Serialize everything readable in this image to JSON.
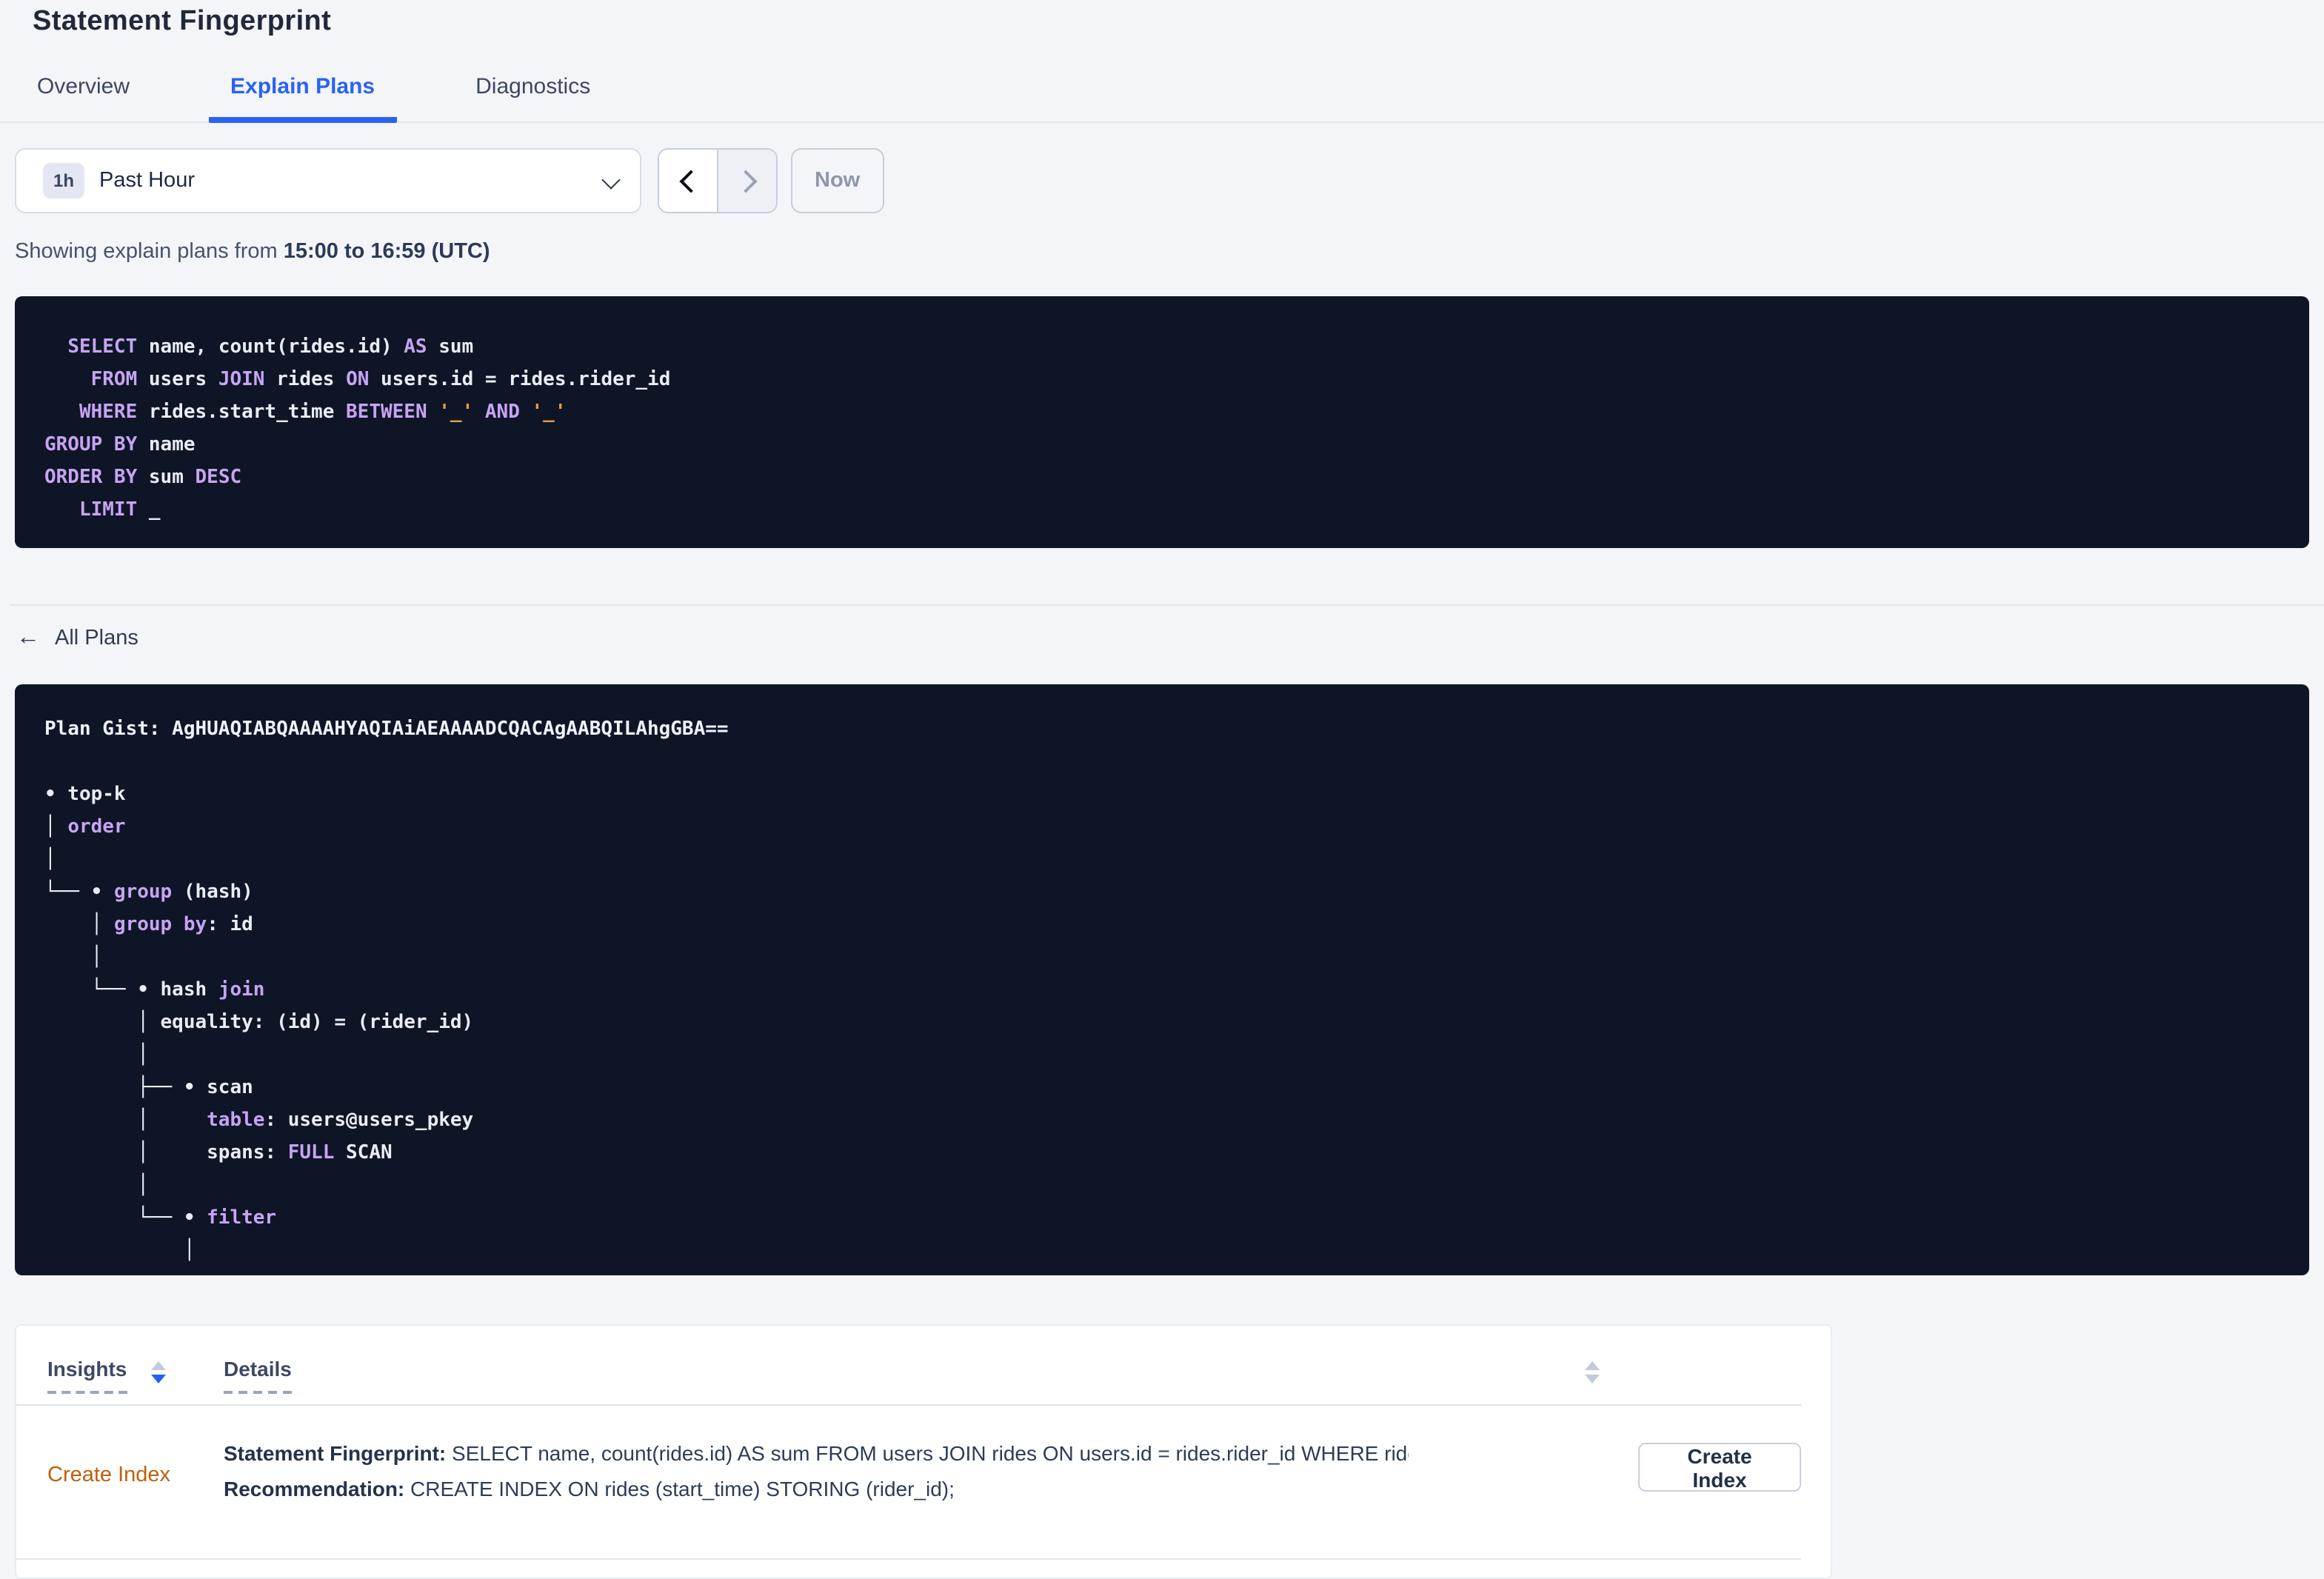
{
  "page": {
    "title": "Statement Fingerprint"
  },
  "tabs": [
    {
      "label": "Overview",
      "active": false
    },
    {
      "label": "Explain Plans",
      "active": true
    },
    {
      "label": "Diagnostics",
      "active": false
    }
  ],
  "time_picker": {
    "badge": "1h",
    "label": "Past Hour",
    "now_label": "Now"
  },
  "showing": {
    "prefix": "Showing explain plans from ",
    "bold": "15:00 to 16:59 (UTC)"
  },
  "sql": {
    "lines": [
      [
        {
          "t": "  ",
          "c": "pl"
        },
        {
          "t": "SELECT",
          "c": "kw"
        },
        {
          "t": " name, count(rides.id) ",
          "c": "pl"
        },
        {
          "t": "AS",
          "c": "kw"
        },
        {
          "t": " sum",
          "c": "pl"
        }
      ],
      [
        {
          "t": "    ",
          "c": "pl"
        },
        {
          "t": "FROM",
          "c": "kw"
        },
        {
          "t": " users ",
          "c": "pl"
        },
        {
          "t": "JOIN",
          "c": "kw"
        },
        {
          "t": " rides ",
          "c": "pl"
        },
        {
          "t": "ON",
          "c": "kw"
        },
        {
          "t": " users.id = rides.rider_id",
          "c": "pl"
        }
      ],
      [
        {
          "t": "   ",
          "c": "pl"
        },
        {
          "t": "WHERE",
          "c": "kw"
        },
        {
          "t": " rides.start_time ",
          "c": "pl"
        },
        {
          "t": "BETWEEN",
          "c": "kw"
        },
        {
          "t": " ",
          "c": "pl"
        },
        {
          "t": "'_'",
          "c": "lit"
        },
        {
          "t": " ",
          "c": "pl"
        },
        {
          "t": "AND",
          "c": "kw"
        },
        {
          "t": " ",
          "c": "pl"
        },
        {
          "t": "'_'",
          "c": "lit"
        }
      ],
      [
        {
          "t": "GROUP BY",
          "c": "kw"
        },
        {
          "t": " name",
          "c": "pl"
        }
      ],
      [
        {
          "t": "ORDER BY",
          "c": "kw"
        },
        {
          "t": " sum ",
          "c": "pl"
        },
        {
          "t": "DESC",
          "c": "kw"
        }
      ],
      [
        {
          "t": "   ",
          "c": "pl"
        },
        {
          "t": "LIMIT",
          "c": "kw"
        },
        {
          "t": " _",
          "c": "pl"
        }
      ]
    ]
  },
  "all_plans": {
    "label": "All Plans",
    "arrow": "←"
  },
  "plan": {
    "lines": [
      [
        {
          "t": "Plan Gist: AgHUAQIABQAAAAHYAQIAiAEAAAADCQACAgAABQILAhgGBA==",
          "c": "b"
        }
      ],
      [
        {
          "t": "",
          "c": "pl"
        }
      ],
      [
        {
          "t": "• top-k",
          "c": "pl"
        }
      ],
      [
        {
          "t": "│ ",
          "c": "pl"
        },
        {
          "t": "order",
          "c": "kw"
        }
      ],
      [
        {
          "t": "│",
          "c": "pl"
        }
      ],
      [
        {
          "t": "└── • ",
          "c": "pl"
        },
        {
          "t": "group",
          "c": "kw"
        },
        {
          "t": " (hash)",
          "c": "pl"
        }
      ],
      [
        {
          "t": "    │ ",
          "c": "pl"
        },
        {
          "t": "group by",
          "c": "kw"
        },
        {
          "t": ": id",
          "c": "pl"
        }
      ],
      [
        {
          "t": "    │",
          "c": "pl"
        }
      ],
      [
        {
          "t": "    └── • hash ",
          "c": "pl"
        },
        {
          "t": "join",
          "c": "kw"
        }
      ],
      [
        {
          "t": "        │ equality: (id) = (rider_id)",
          "c": "pl"
        }
      ],
      [
        {
          "t": "        │",
          "c": "pl"
        }
      ],
      [
        {
          "t": "        ├── • scan",
          "c": "pl"
        }
      ],
      [
        {
          "t": "        │     ",
          "c": "pl"
        },
        {
          "t": "table",
          "c": "kw"
        },
        {
          "t": ": users@users_pkey",
          "c": "pl"
        }
      ],
      [
        {
          "t": "        │     spans: ",
          "c": "pl"
        },
        {
          "t": "FULL",
          "c": "kw"
        },
        {
          "t": " SCAN",
          "c": "pl"
        }
      ],
      [
        {
          "t": "        │",
          "c": "pl"
        }
      ],
      [
        {
          "t": "        └── • ",
          "c": "pl"
        },
        {
          "t": "filter",
          "c": "kw"
        }
      ],
      [
        {
          "t": "            │",
          "c": "pl"
        }
      ]
    ]
  },
  "insights_table": {
    "columns": [
      {
        "label": "Insights",
        "sort": "desc"
      },
      {
        "label": "Details",
        "sort": "none"
      }
    ],
    "row": {
      "insight": "Create Index",
      "fingerprint_label": "Statement Fingerprint:",
      "fingerprint_value": " SELECT name, count(rides.id) AS sum FROM users JOIN rides ON users.id = rides.rider_id WHERE rides.start_time BETWEEN '_…",
      "recommendation_label": "Recommendation:",
      "recommendation_value": " CREATE INDEX ON rides (start_time) STORING (rider_id);",
      "button_label": "Create Index"
    }
  },
  "colors": {
    "accent_blue": "#2962f5",
    "code_background": "#0e1526",
    "code_keyword": "#c7a4f2",
    "code_plain": "#e9edf5",
    "code_literal": "#ed9b40",
    "insight_link_orange": "#bf600f",
    "page_background": "#f4f5f9"
  }
}
